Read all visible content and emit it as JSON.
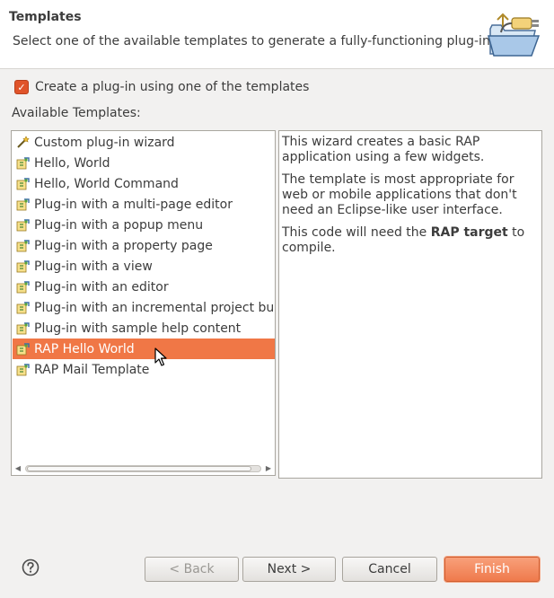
{
  "header": {
    "title": "Templates",
    "description": "Select one of the available templates to generate a fully-functioning plug-in.",
    "icon": "wizard-folder-plug-icon"
  },
  "use_template": {
    "label": "Create a plug-in using one of the templates",
    "checked": true
  },
  "templates": {
    "label": "Available Templates:",
    "items": [
      {
        "label": "Custom plug-in wizard",
        "icon": "wand-icon",
        "selected": false
      },
      {
        "label": "Hello, World",
        "icon": "template-icon",
        "selected": false
      },
      {
        "label": "Hello, World Command",
        "icon": "template-icon",
        "selected": false
      },
      {
        "label": "Plug-in with a multi-page editor",
        "icon": "template-icon",
        "selected": false
      },
      {
        "label": "Plug-in with a popup menu",
        "icon": "template-icon",
        "selected": false
      },
      {
        "label": "Plug-in with a property page",
        "icon": "template-icon",
        "selected": false
      },
      {
        "label": "Plug-in with a view",
        "icon": "template-icon",
        "selected": false
      },
      {
        "label": "Plug-in with an editor",
        "icon": "template-icon",
        "selected": false
      },
      {
        "label": "Plug-in with an incremental project builde",
        "icon": "template-icon",
        "selected": false
      },
      {
        "label": "Plug-in with sample help content",
        "icon": "template-icon",
        "selected": false
      },
      {
        "label": "RAP Hello World",
        "icon": "template-icon",
        "selected": true
      },
      {
        "label": "RAP Mail Template",
        "icon": "template-icon",
        "selected": false
      }
    ]
  },
  "description": {
    "p1": "This wizard creates a basic RAP application using a few widgets.",
    "p2": "The template is most appropriate for web or mobile applications that don't need an Eclipse-like user interface.",
    "p3_prefix": "This code will need the ",
    "p3_bold": "RAP target",
    "p3_suffix": " to compile."
  },
  "buttons": {
    "back": "< Back",
    "next": "Next >",
    "cancel": "Cancel",
    "finish": "Finish"
  },
  "colors": {
    "accent": "#f07746",
    "header_bg": "#ffffff",
    "dialog_bg": "#f2f1f0"
  }
}
